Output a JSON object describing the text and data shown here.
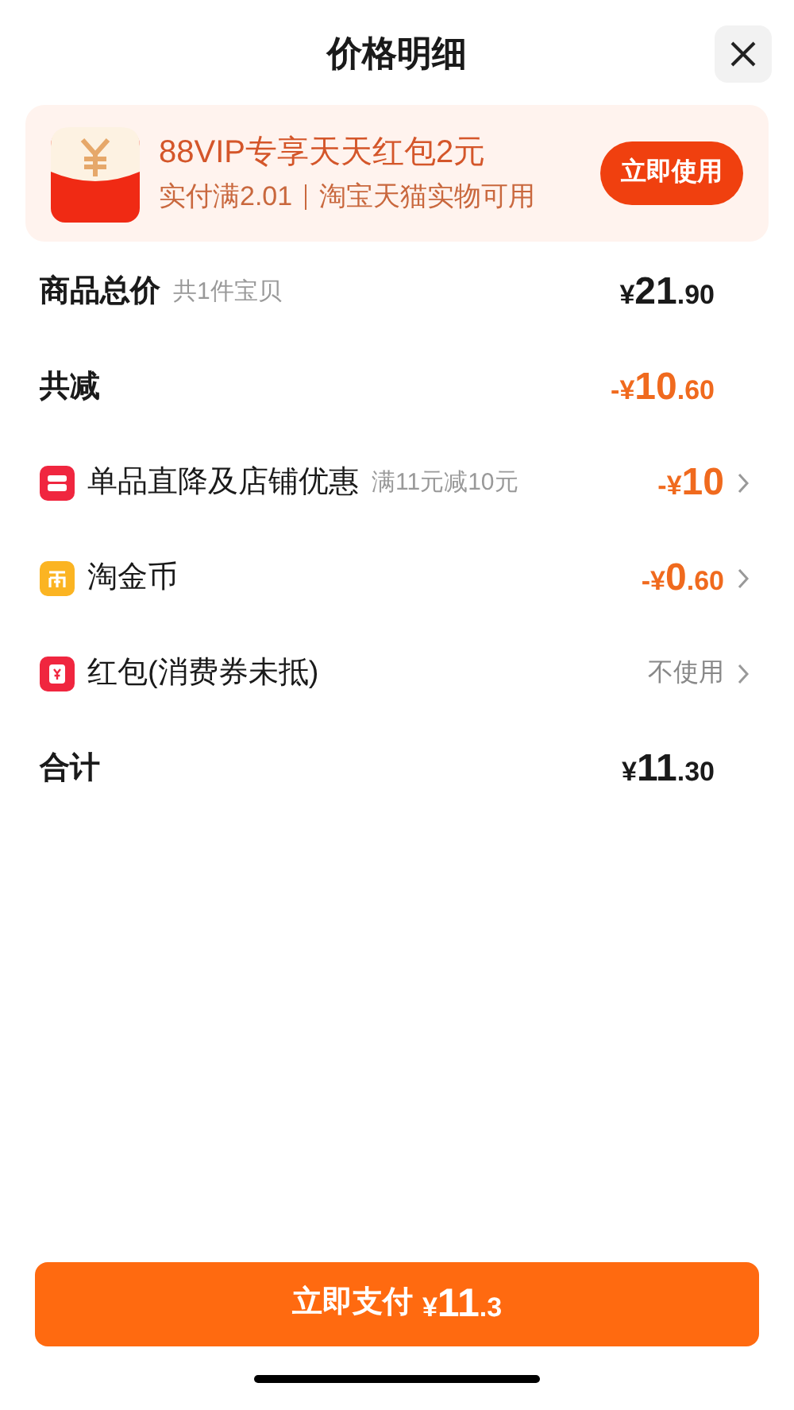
{
  "title": "价格明细",
  "banner": {
    "headline": "88VIP专享天天红包2元",
    "condition": "实付满2.01",
    "scope": "淘宝天猫实物可用",
    "button": "立即使用"
  },
  "rows": [
    {
      "kind": "summary",
      "label": "商品总价",
      "note": "共1件宝贝",
      "value": "¥21.90",
      "highlight": false
    },
    {
      "kind": "summary",
      "label": "共减",
      "value": "-¥10.60",
      "highlight": true
    },
    {
      "kind": "item",
      "label": "单品直降及店铺优惠",
      "note": "满11元减10元",
      "value": "-¥10",
      "highlight": true
    },
    {
      "kind": "item",
      "label": "淘金币",
      "value": "-¥0.60",
      "highlight": true
    },
    {
      "kind": "item",
      "label": "红包(消费券未抵)",
      "value": "不使用",
      "highlight": false
    },
    {
      "kind": "summary",
      "label": "合计",
      "value": "¥11.30",
      "highlight": false
    }
  ],
  "pay_button": {
    "label": "立即支付",
    "amount": "¥11.3"
  }
}
